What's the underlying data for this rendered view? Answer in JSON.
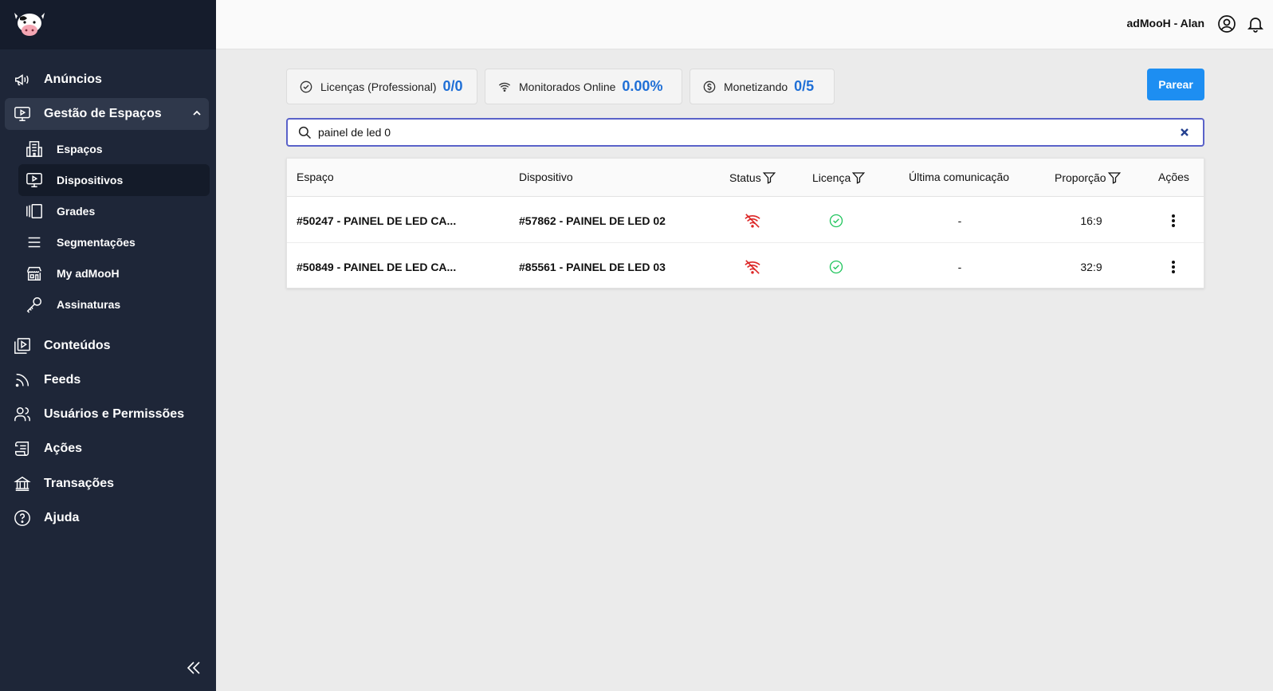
{
  "app": {
    "logo": "cow-logo"
  },
  "sidebar": {
    "items": [
      {
        "label": "Anúncios",
        "icon": "megaphone-icon"
      },
      {
        "label": "Gestão de Espaços",
        "icon": "monitor-play-icon",
        "expanded": true
      },
      {
        "label": "Conteúdos",
        "icon": "media-library-icon"
      },
      {
        "label": "Feeds",
        "icon": "rss-icon"
      },
      {
        "label": "Usuários e Permissões",
        "icon": "users-icon"
      },
      {
        "label": "Ações",
        "icon": "scroll-icon"
      },
      {
        "label": "Transações",
        "icon": "bank-icon"
      },
      {
        "label": "Ajuda",
        "icon": "help-circle-icon"
      }
    ],
    "subitems": [
      {
        "label": "Espaços",
        "icon": "building-icon"
      },
      {
        "label": "Dispositivos",
        "icon": "monitor-play-icon",
        "active": true
      },
      {
        "label": "Grades",
        "icon": "columns-icon"
      },
      {
        "label": "Segmentações",
        "icon": "menu-icon"
      },
      {
        "label": "My adMooH",
        "icon": "store-icon"
      },
      {
        "label": "Assinaturas",
        "icon": "key-icon"
      }
    ]
  },
  "header": {
    "user": "adMooH - Alan"
  },
  "stats": [
    {
      "label": "Licenças (Professional)",
      "value": "0/0",
      "icon": "check-circle-icon"
    },
    {
      "label": "Monitorados Online",
      "value": "0.00%",
      "icon": "wifi-icon"
    },
    {
      "label": "Monetizando",
      "value": "0/5",
      "icon": "dollar-circle-icon"
    }
  ],
  "actions": {
    "pair_label": "Parear"
  },
  "search": {
    "value": "painel de led 0"
  },
  "table": {
    "columns": [
      "Espaço",
      "Dispositivo",
      "Status",
      "Licença",
      "Última comunicação",
      "Proporção",
      "Ações"
    ],
    "rows": [
      {
        "space": "#50247 - PAINEL DE LED CA...",
        "device": "#57862 - PAINEL DE LED 02",
        "status": "offline",
        "license": "valid",
        "last_comm": "-",
        "ratio": "16:9"
      },
      {
        "space": "#50849 - PAINEL DE LED CA...",
        "device": "#85561 - PAINEL DE LED 03",
        "status": "offline",
        "license": "valid",
        "last_comm": "-",
        "ratio": "32:9"
      }
    ]
  },
  "colors": {
    "sidebar_bg": "#1e2638",
    "accent_blue": "#1d8ef2",
    "stat_value": "#1f6fd6",
    "offline_red": "#dc2626",
    "license_green": "#22c55e"
  }
}
